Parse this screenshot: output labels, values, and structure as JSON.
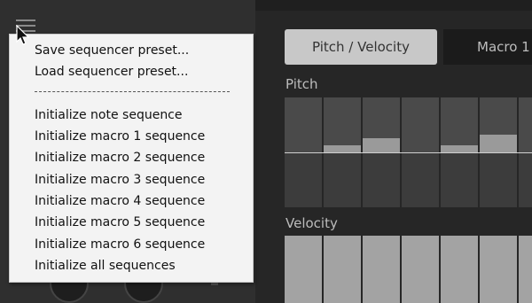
{
  "menu": {
    "items": [
      "Save sequencer preset...",
      "Load sequencer preset...",
      "Initialize note sequence",
      "Initialize macro 1 sequence",
      "Initialize macro 2 sequence",
      "Initialize macro 3 sequence",
      "Initialize macro 4 sequence",
      "Initialize macro 5 sequence",
      "Initialize macro 6 sequence",
      "Initialize all sequences"
    ],
    "separator": "-----------------------------------------"
  },
  "tabs": {
    "pitch_velocity": "Pitch / Velocity",
    "macro1": "Macro 1"
  },
  "sections": {
    "pitch": "Pitch",
    "velocity": "Velocity"
  },
  "pitch_steps": [
    0,
    1,
    2,
    0,
    1,
    2.5,
    0
  ],
  "icons": {
    "menu": "hamburger-icon",
    "cursor": "mouse-cursor-icon"
  },
  "colors": {
    "active_tab": "#c8c8c8",
    "menu_bg": "#f3f3f3",
    "cell": "#4a4a4a",
    "velocity_bar": "#a3a3a3"
  }
}
